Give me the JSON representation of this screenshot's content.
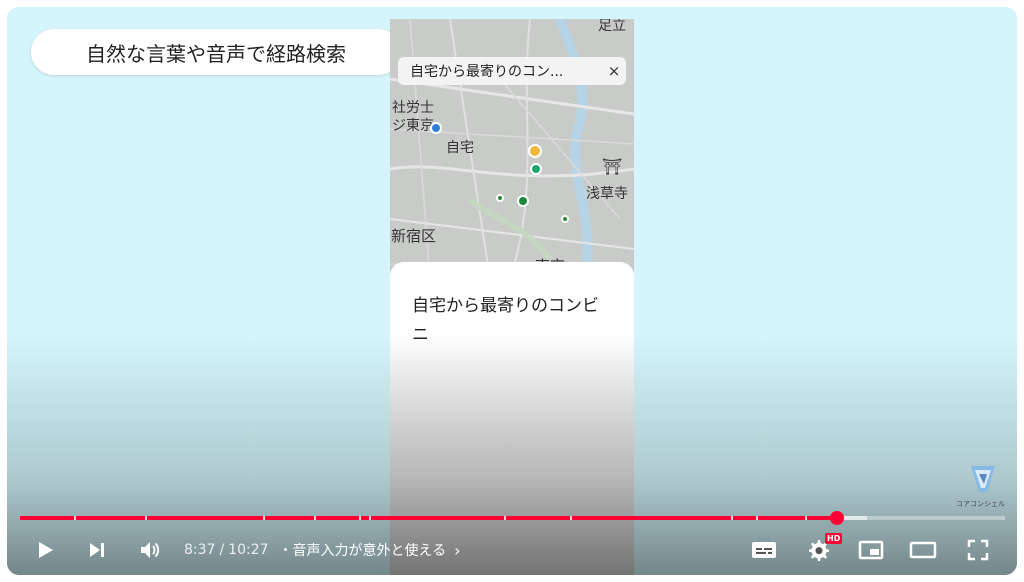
{
  "caption": {
    "text": "自然な言葉や音声で経路検索"
  },
  "phone": {
    "search_chip": {
      "text": "自宅から最寄りのコン...",
      "close": "×"
    },
    "map_labels": {
      "adachi": "足立",
      "shibou": "社労士",
      "tokyo": "ジ東京",
      "home": "自宅",
      "shinjuku": "新宿区",
      "asakusa": "浅草寺",
      "bottom": "東京"
    },
    "sheet_text": "自宅から最寄りのコンビニ"
  },
  "watermark": {
    "text": "コアコンシェル"
  },
  "player": {
    "progress": {
      "played_fraction": 0.829,
      "buffered_fraction": 0.86
    },
    "time": {
      "current": "8:37",
      "separator": "/",
      "duration": "10:27"
    },
    "chapter": {
      "bullet": "・",
      "title": "音声入力が意外と使える",
      "chevron": "›"
    },
    "hd_badge": "HD",
    "icons": {
      "play": "play-icon",
      "next": "next-icon",
      "volume": "volume-icon",
      "subtitles": "subtitles-icon",
      "settings": "gear-icon",
      "miniplayer": "miniplayer-icon",
      "theater": "theater-mode-icon",
      "fullscreen": "fullscreen-icon"
    },
    "accent_color": "#ff0033"
  }
}
